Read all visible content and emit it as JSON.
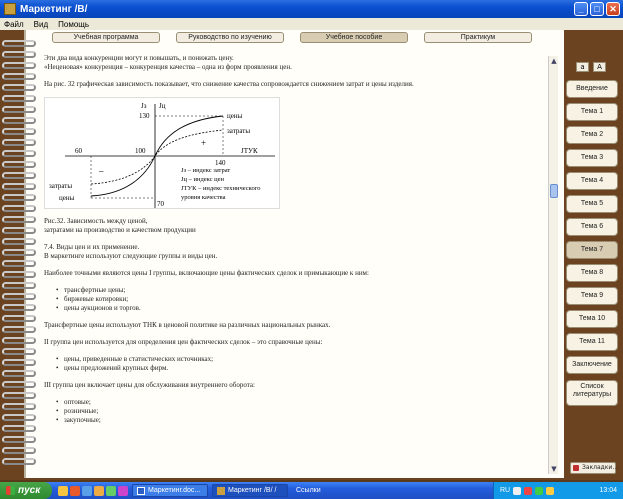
{
  "window": {
    "title": "Маркетинг /В/"
  },
  "menu": {
    "items": [
      "Файл",
      "Вид",
      "Помощь"
    ]
  },
  "top_tabs": [
    "Учебная программа",
    "Руководство по изучению",
    "Учебное пособие",
    "Практикум"
  ],
  "content": {
    "p1": "Эти два вида конкуренции могут и повышать, и понижать цену.",
    "p2": "«Неценовая» конкуренция – конкуренция качества – одна из форм проявления цен.",
    "p3": "На рис. 32 графическая зависимость показывает, что снижение качества сопровождается снижением затрат и цены изделия.",
    "figure": {
      "y_axis1": "Jз",
      "y_axis2": "Jц",
      "x_axis": "JТУК",
      "tick_130": "130",
      "tick_100": "100",
      "tick_60": "60",
      "tick_140": "140",
      "tick_70": "70",
      "label_prices": "цены",
      "label_costs": "затраты",
      "label_costs_left": "затраты",
      "label_prices_left": "цены",
      "sign_minus": "–",
      "sign_plus": "+",
      "legend_1": "Jз – индекс затрат",
      "legend_2": "Jц – индекс цен",
      "legend_3": "JТУК – индекс технического",
      "legend_4": "уровня качества"
    },
    "caption_1": "Рис.32. Зависимость между ценой,",
    "caption_2": "затратами на производство и качеством продукции",
    "section_title": "7.4. Виды цен и их применение.",
    "section_intro": "В маркетинге используют следующие группы и виды цен.",
    "group1": "Наиболее точными являются цены I группы, включающие цены фактических сделок и примыкающие к ним:",
    "group1_list": [
      "трансфертные цены;",
      "биржевые котировки;",
      "цены аукционов и торгов."
    ],
    "tnk": "Трансфертные цены используют ТНК в ценовой политике на различных национальных рынках.",
    "group2": "II группа цен используется для определения цен фактических сделок – это справочные цены:",
    "group2_list": [
      "цены, приведенные в статистических источниках;",
      "цены предложений крупных фирм."
    ],
    "group3": "III группа цен включает цены для обслуживания внутреннего оборота:",
    "group3_list": [
      "оптовые;",
      "розничные;",
      "закупочные;"
    ]
  },
  "font_buttons": [
    "a",
    "A"
  ],
  "side_tabs": [
    "Введение",
    "Тема 1",
    "Тема 2",
    "Тема 3",
    "Тема 4",
    "Тема 5",
    "Тема 6",
    "Тема 7",
    "Тема 8",
    "Тема 9",
    "Тема 10",
    "Тема 11",
    "Заключение",
    "Список",
    "литературы"
  ],
  "bookmarks_label": "Закладки...",
  "taskbar": {
    "start": "пуск",
    "task1": "Маркетинг.doc...",
    "task2": "Маркетинг /В/ /",
    "links": "Ссылки",
    "lang": "RU",
    "clock": "13:04"
  }
}
